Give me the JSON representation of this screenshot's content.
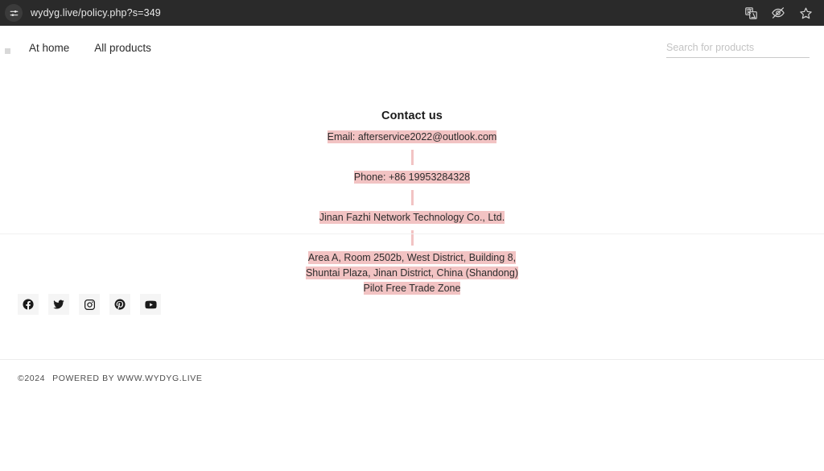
{
  "browser": {
    "url": "wydyg.live/policy.php?s=349",
    "tune_icon": "sliders-icon",
    "icons": [
      {
        "name": "translate-icon",
        "label": "Translate this page"
      },
      {
        "name": "eye-off-icon",
        "label": "Hide"
      },
      {
        "name": "star-icon",
        "label": "Bookmark"
      }
    ]
  },
  "header": {
    "brand_mark": "site-logo",
    "nav": [
      {
        "label": "At home"
      },
      {
        "label": "All products"
      }
    ],
    "search": {
      "placeholder": "Search for products",
      "value": ""
    }
  },
  "main": {
    "title": "Contact us",
    "email_line": "Email: afterservice2022@outlook.com",
    "phone_line": "Phone: +86 19953284328",
    "company_line": "Jinan Fazhi Network Technology Co., Ltd.",
    "address_line": "Area A, Room 2502b, West District, Building 8, Shuntai Plaza, Jinan District, China (Shandong) Pilot Free Trade Zone"
  },
  "social": [
    {
      "name": "facebook-icon",
      "label": "Facebook"
    },
    {
      "name": "twitter-icon",
      "label": "Twitter"
    },
    {
      "name": "instagram-icon",
      "label": "Instagram"
    },
    {
      "name": "pinterest-icon",
      "label": "Pinterest"
    },
    {
      "name": "youtube-icon",
      "label": "YouTube"
    }
  ],
  "footer": {
    "copyright": "©2024",
    "powered_by": "POWERED BY WWW.WYDYG.LIVE"
  },
  "colors": {
    "highlight": "#f2c3c3",
    "chrome_bg": "#2a2a2a",
    "page_bg": "#ffffff",
    "text": "#2c2c2c"
  }
}
